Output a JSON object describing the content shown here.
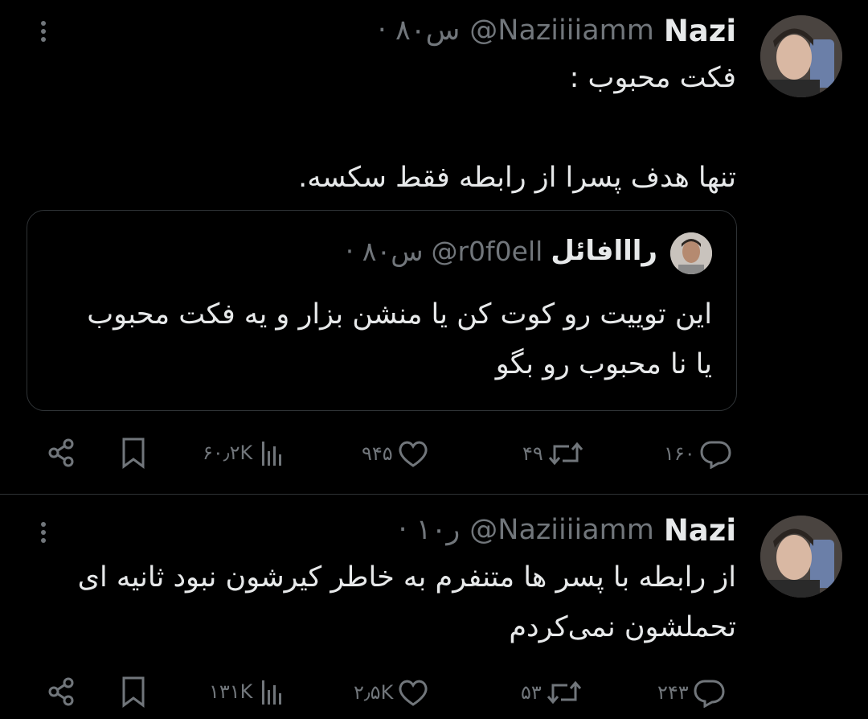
{
  "tweets": [
    {
      "author": {
        "name": "Nazi",
        "handle": "@Naziiiiamm"
      },
      "meta": "· ۸۰س",
      "text": "فکت محبوب :\n\nتنها هدف پسرا از رابطه فقط سکسه.",
      "quote": {
        "author": {
          "name": "رااافائل",
          "handle": "@r0f0ell"
        },
        "meta": "· ۸۰س",
        "text": "این توییت رو کوت کن یا منشن بزار و یه فکت محبوب یا نا محبوب رو بگو"
      },
      "stats": {
        "replies": "۱۶۰",
        "retweets": "۴۹",
        "likes": "۹۴۵",
        "views": "۶۰٫۲K"
      }
    },
    {
      "author": {
        "name": "Nazi",
        "handle": "@Naziiiiamm"
      },
      "meta": "· ۱۰ر",
      "text": "از رابطه با پسر ها متنفرم به خاطر کیرشون نبود ثانیه ای تحملشون نمی‌کردم",
      "stats": {
        "replies": "۲۴۳",
        "retweets": "۵۳",
        "likes": "۲٫۵K",
        "views": "۱۳۱K"
      }
    }
  ],
  "icons": {
    "reply": "reply-icon",
    "retweet": "retweet-icon",
    "like": "heart-icon",
    "views": "views-icon",
    "bookmark": "bookmark-icon",
    "share": "share-icon",
    "more": "more-icon"
  },
  "colors": {
    "background": "#000000",
    "text": "#e7e9ea",
    "muted": "#71767b",
    "border": "#2f3336"
  }
}
